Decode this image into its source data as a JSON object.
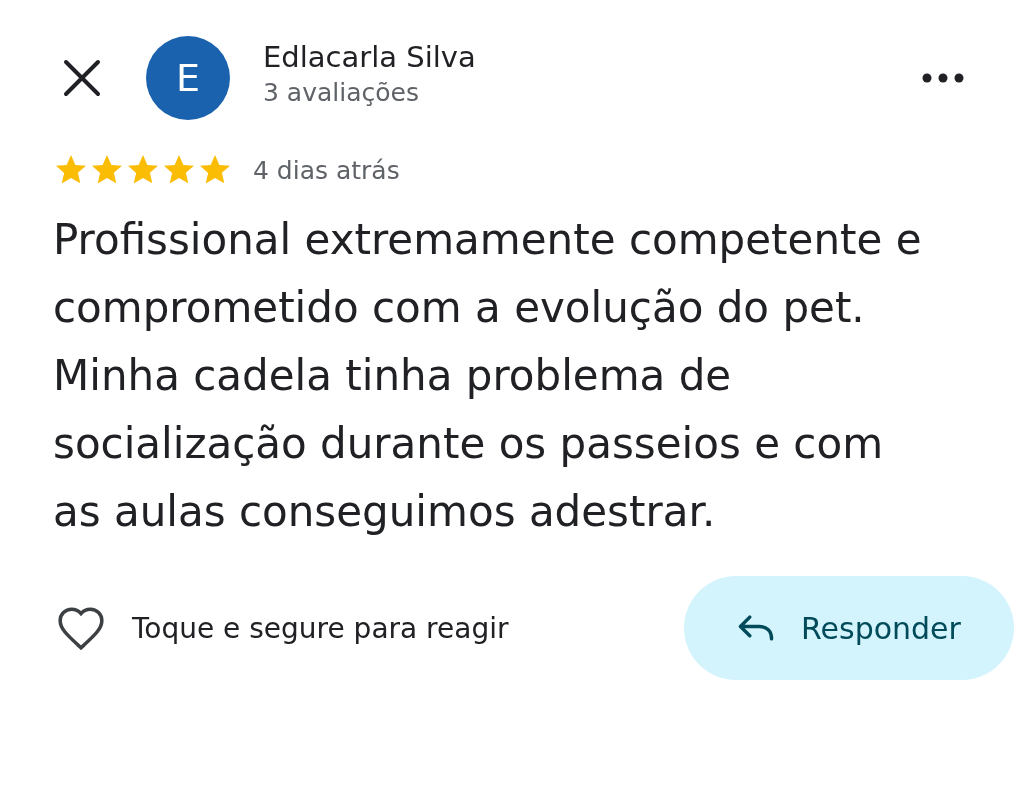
{
  "reviewer": {
    "initial": "E",
    "name": "Edlacarla Silva",
    "review_count": "3 avaliações"
  },
  "review": {
    "stars": 5,
    "time": "4 dias atrás",
    "text": "Profissional extremamente competente e comprometido com a evolução do pet. Minha cadela tinha problema de socialização durante os passeios e com as aulas conseguimos adestrar."
  },
  "react": {
    "label": "Toque e segure para reagir"
  },
  "reply_button": {
    "label": "Responder"
  }
}
